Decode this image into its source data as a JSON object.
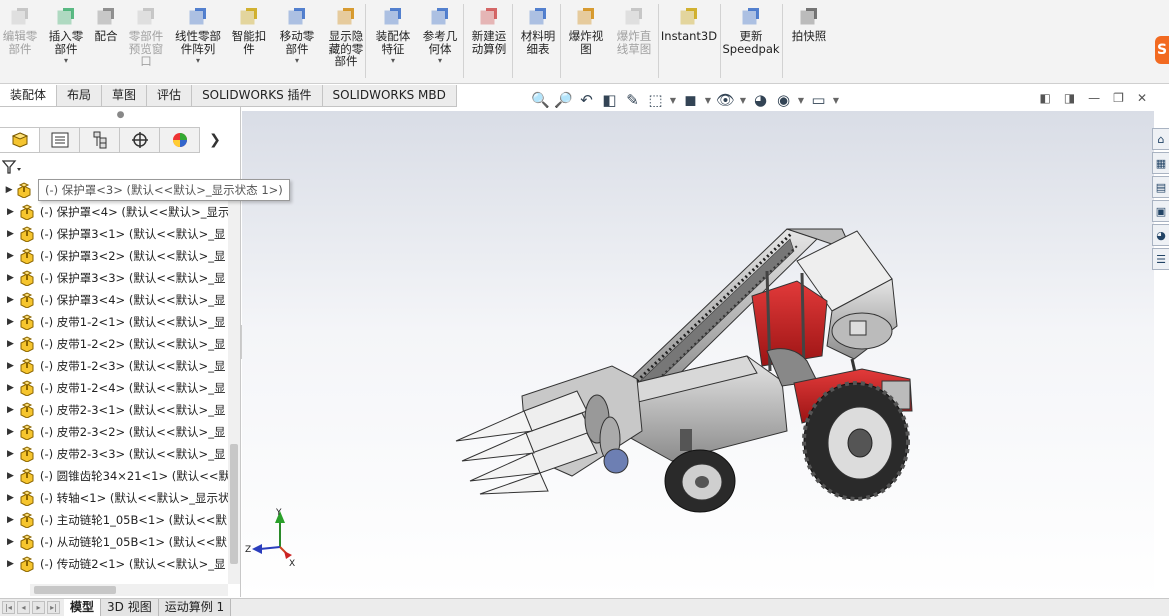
{
  "ribbon": {
    "buttons": [
      {
        "label": "编辑零\n部件",
        "icon": "edit-component-icon",
        "enabled": false
      },
      {
        "label": "插入零\n部件",
        "icon": "insert-component-icon",
        "enabled": true,
        "dropdown": true
      },
      {
        "label": "配合",
        "icon": "mate-icon",
        "enabled": true
      },
      {
        "label": "零部件\n预览窗\n口",
        "icon": "component-preview-icon",
        "enabled": false
      },
      {
        "label": "线性零部\n件阵列",
        "icon": "linear-pattern-icon",
        "enabled": true,
        "dropdown": true
      },
      {
        "label": "智能扣\n件",
        "icon": "smart-fastener-icon",
        "enabled": true
      },
      {
        "label": "移动零\n部件",
        "icon": "move-component-icon",
        "enabled": true,
        "dropdown": true
      },
      {
        "label": "显示隐\n藏的零\n部件",
        "icon": "show-hidden-icon",
        "enabled": true
      },
      {
        "label": "装配体\n特征",
        "icon": "assembly-feature-icon",
        "enabled": true,
        "dropdown": true
      },
      {
        "label": "参考几\n何体",
        "icon": "reference-geometry-icon",
        "enabled": true,
        "dropdown": true
      },
      {
        "label": "新建运\n动算例",
        "icon": "new-motion-study-icon",
        "enabled": true
      },
      {
        "label": "材料明\n细表",
        "icon": "bill-of-materials-icon",
        "enabled": true
      },
      {
        "label": "爆炸视\n图",
        "icon": "exploded-view-icon",
        "enabled": true
      },
      {
        "label": "爆炸直\n线草图",
        "icon": "explode-line-sketch-icon",
        "enabled": false
      },
      {
        "label": "Instant3D",
        "icon": "instant3d-icon",
        "enabled": true
      },
      {
        "label": "更新\nSpeedpak",
        "icon": "speedpak-icon",
        "enabled": true
      },
      {
        "label": "拍快照",
        "icon": "snapshot-icon",
        "enabled": true
      }
    ],
    "sogou_label": "S"
  },
  "tabs": [
    {
      "label": "装配体",
      "active": true
    },
    {
      "label": "布局"
    },
    {
      "label": "草图"
    },
    {
      "label": "评估"
    },
    {
      "label": "SOLIDWORKS 插件"
    },
    {
      "label": "SOLIDWORKS MBD"
    }
  ],
  "tree": {
    "tooltip": "(-) 保护罩<3> (默认<<默认>_显示状态 1>)",
    "items": [
      "(-) 保护罩<3> (默认<<默认>_显示状态 1>)",
      "(-) 保护罩<4> (默认<<默认>_显示",
      "(-) 保护罩3<1> (默认<<默认>_显",
      "(-) 保护罩3<2> (默认<<默认>_显",
      "(-) 保护罩3<3> (默认<<默认>_显",
      "(-) 保护罩3<4> (默认<<默认>_显",
      "(-) 皮带1-2<1> (默认<<默认>_显",
      "(-) 皮带1-2<2> (默认<<默认>_显",
      "(-) 皮带1-2<3> (默认<<默认>_显",
      "(-) 皮带1-2<4> (默认<<默认>_显",
      "(-) 皮带2-3<1> (默认<<默认>_显",
      "(-) 皮带2-3<2> (默认<<默认>_显",
      "(-) 皮带2-3<3> (默认<<默认>_显",
      "(-) 圆锥齿轮34×21<1> (默认<<默",
      "(-) 转轴<1> (默认<<默认>_显示状",
      "(-) 主动链轮1_05B<1> (默认<<默",
      "(-) 从动链轮1_05B<1> (默认<<默",
      "(-) 传动链2<1> (默认<<默认>_显"
    ]
  },
  "triad": {
    "x": "X",
    "y": "Y",
    "z": "Z"
  },
  "bottom_tabs": [
    {
      "label": "模型",
      "active": true
    },
    {
      "label": "3D 视图"
    },
    {
      "label": "运动算例 1"
    }
  ]
}
